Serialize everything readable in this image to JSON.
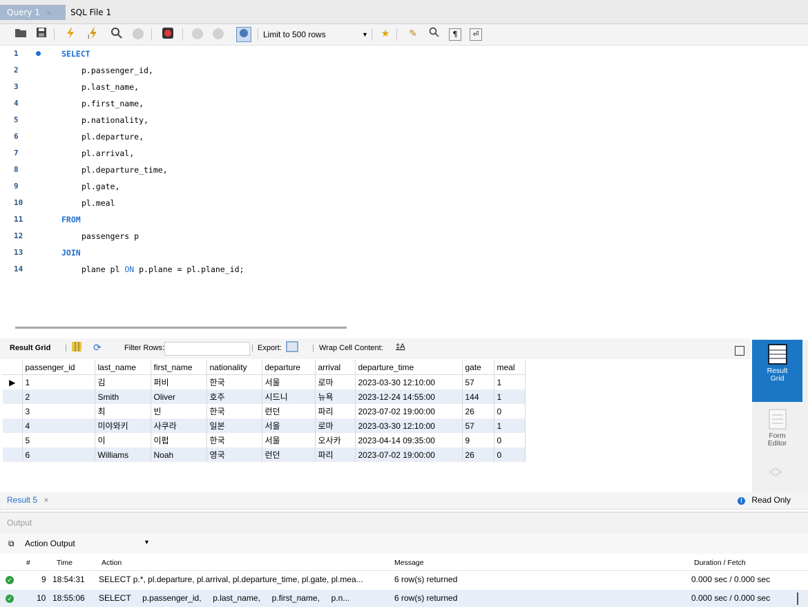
{
  "tabs": [
    {
      "label": "Query 1",
      "close": "×"
    },
    {
      "label": "SQL File 1"
    }
  ],
  "toolbar": {
    "icons": [
      "open-folder-icon",
      "save-icon",
      "execute-icon",
      "execute-current-icon",
      "explain-icon",
      "stop-icon",
      "toggle-error-icon",
      "commit-icon",
      "rollback-icon",
      "autocommit-icon",
      "bookmark-icon",
      "beautify-icon",
      "find-icon",
      "invisible-chars-icon",
      "wrap-icon"
    ],
    "limit": "Limit to 500 rows"
  },
  "editor": {
    "lines": [
      {
        "num": "1",
        "kw": "SELECT",
        "text": ""
      },
      {
        "num": "2",
        "kw": "",
        "text": "p.passenger_id,"
      },
      {
        "num": "3",
        "kw": "",
        "text": "p.last_name,"
      },
      {
        "num": "4",
        "kw": "",
        "text": "p.first_name,"
      },
      {
        "num": "5",
        "kw": "",
        "text": "p.nationality,"
      },
      {
        "num": "6",
        "kw": "",
        "text": "pl.departure,"
      },
      {
        "num": "7",
        "kw": "",
        "text": "pl.arrival,"
      },
      {
        "num": "8",
        "kw": "",
        "text": "pl.departure_time,"
      },
      {
        "num": "9",
        "kw": "",
        "text": "pl.gate,"
      },
      {
        "num": "10",
        "kw": "",
        "text": "pl.meal"
      },
      {
        "num": "11",
        "kw": "FROM",
        "text": ""
      },
      {
        "num": "12",
        "kw": "",
        "text": "passengers p"
      },
      {
        "num": "13",
        "kw": "JOIN",
        "text": ""
      },
      {
        "num": "14",
        "kw": "",
        "text": "plane pl ON p.plane = pl.plane_id;"
      }
    ],
    "line14_parts": [
      "plane pl ",
      "ON",
      " p.plane = pl.plane_id;"
    ]
  },
  "result_toolbar": {
    "result_grid": "Result Grid",
    "filter_rows": "Filter Rows:",
    "export": "Export:",
    "wrap": "Wrap Cell Content:"
  },
  "grid": {
    "columns": [
      "passenger_id",
      "last_name",
      "first_name",
      "nationality",
      "departure",
      "arrival",
      "departure_time",
      "gate",
      "meal"
    ],
    "rows": [
      [
        "1",
        "김",
        "퍼비",
        "한국",
        "서울",
        "로마",
        "2023-03-30 12:10:00",
        "57",
        "1"
      ],
      [
        "2",
        "Smith",
        "Oliver",
        "호주",
        "시드니",
        "뉴욕",
        "2023-12-24 14:55:00",
        "144",
        "1"
      ],
      [
        "3",
        "최",
        "빈",
        "한국",
        "런던",
        "파리",
        "2023-07-02 19:00:00",
        "26",
        "0"
      ],
      [
        "4",
        "미야와키",
        "사쿠라",
        "일본",
        "서울",
        "로마",
        "2023-03-30 12:10:00",
        "57",
        "1"
      ],
      [
        "5",
        "이",
        "이펍",
        "한국",
        "서울",
        "오사카",
        "2023-04-14 09:35:00",
        "9",
        "0"
      ],
      [
        "6",
        "Williams",
        "Noah",
        "영국",
        "런던",
        "파리",
        "2023-07-02 19:00:00",
        "26",
        "0"
      ]
    ]
  },
  "side_panel": {
    "result_grid": "Result Grid",
    "form_editor": "Form Editor"
  },
  "result_tab": {
    "label": "Result 5",
    "close": "×",
    "read_only": "Read Only"
  },
  "output": {
    "title": "Output",
    "selector": "Action Output",
    "columns": [
      "#",
      "Time",
      "Action",
      "Message",
      "Duration / Fetch"
    ],
    "rows": [
      {
        "num": "9",
        "time": "18:54:31",
        "action": "SELECT p.*, pl.departure, pl.arrival, pl.departure_time, pl.gate, pl.mea...",
        "message": "6 row(s) returned",
        "duration": "0.000 sec / 0.000 sec"
      },
      {
        "num": "10",
        "time": "18:55:06",
        "action": "SELECT     p.passenger_id,     p.last_name,     p.first_name,     p.n...",
        "message": "6 row(s) returned",
        "duration": "0.000 sec / 0.000 sec"
      }
    ]
  }
}
